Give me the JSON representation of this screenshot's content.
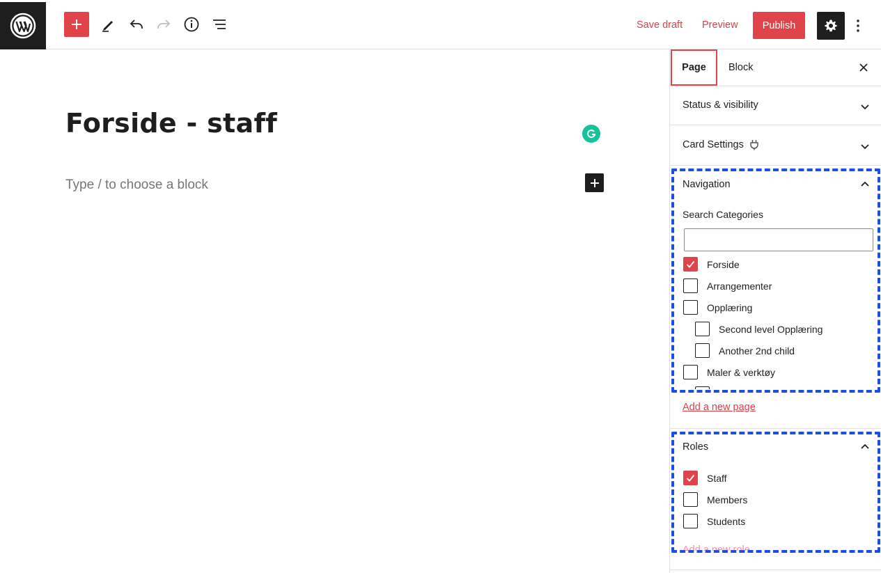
{
  "toolbar": {
    "logo_icon": "wordpress-logo-icon",
    "add_block_icon": "plus-icon",
    "tools_icon": "pencil-icon",
    "undo_icon": "undo-icon",
    "redo_icon": "redo-icon",
    "details_icon": "info-icon",
    "list_view_icon": "list-view-icon",
    "save_draft": "Save draft",
    "preview": "Preview",
    "publish": "Publish",
    "settings_icon": "gear-icon",
    "more_icon": "more-vertical-icon"
  },
  "editor": {
    "title": "Forside - staff",
    "block_placeholder": "Type / to choose a block"
  },
  "sidebar": {
    "tabs": [
      {
        "label": "Page",
        "active": true
      },
      {
        "label": "Block",
        "active": false
      }
    ],
    "close_icon": "close-icon",
    "panels": {
      "status": {
        "title": "Status & visibility"
      },
      "card": {
        "title": "Card Settings"
      },
      "navigation": {
        "title": "Navigation",
        "search_label": "Search Categories",
        "search_value": "",
        "categories": [
          {
            "label": "Forside",
            "checked": true,
            "level": 0
          },
          {
            "label": "Arrangementer",
            "checked": false,
            "level": 0
          },
          {
            "label": "Opplæring",
            "checked": false,
            "level": 0
          },
          {
            "label": "Second level Opplæring",
            "checked": false,
            "level": 1
          },
          {
            "label": "Another 2nd child",
            "checked": false,
            "level": 1
          },
          {
            "label": "Maler & verktøy",
            "checked": false,
            "level": 0
          }
        ],
        "add_link": "Add a new page"
      },
      "roles": {
        "title": "Roles",
        "items": [
          {
            "label": "Staff",
            "checked": true
          },
          {
            "label": "Members",
            "checked": false
          },
          {
            "label": "Students",
            "checked": false
          }
        ],
        "add_link_partial": "Add a new role"
      }
    }
  },
  "colors": {
    "accent": "#e0434a",
    "link": "#d94048",
    "highlight_outline": "#1a4fe0",
    "dark": "#1e1e1e",
    "grammarly": "#15c39a"
  }
}
